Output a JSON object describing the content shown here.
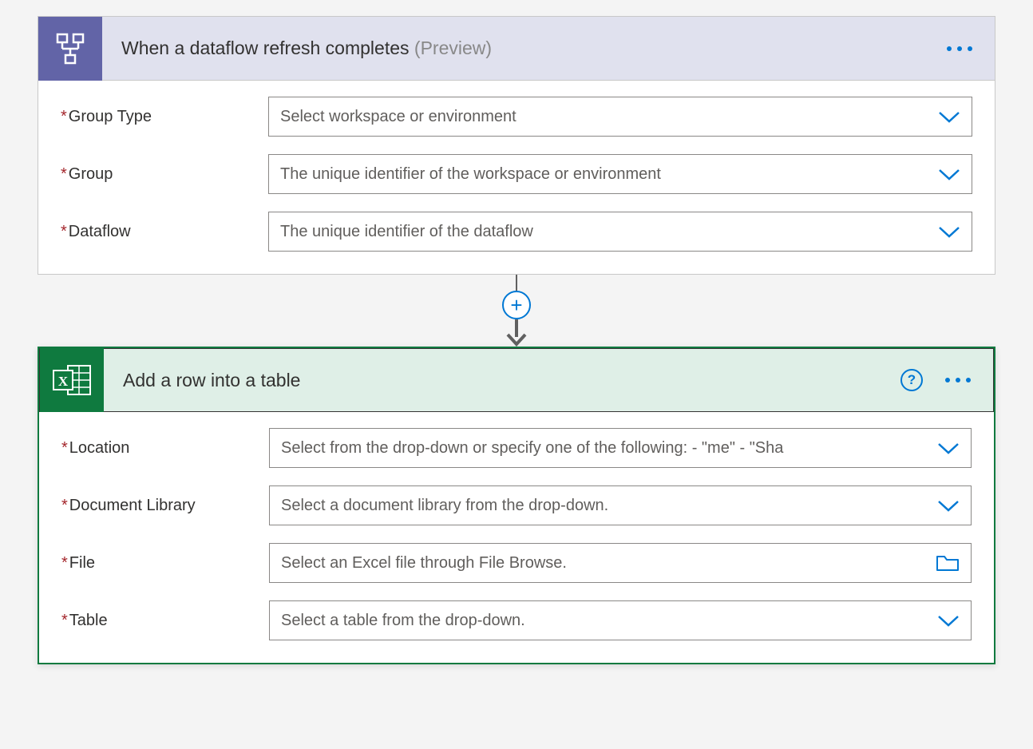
{
  "trigger": {
    "title": "When a dataflow refresh completes",
    "preview": "(Preview)",
    "fields": {
      "groupType": {
        "label": "Group Type",
        "placeholder": "Select workspace or environment"
      },
      "group": {
        "label": "Group",
        "placeholder": "The unique identifier of the workspace or environment"
      },
      "dataflow": {
        "label": "Dataflow",
        "placeholder": "The unique identifier of the dataflow"
      }
    }
  },
  "action": {
    "title": "Add a row into a table",
    "fields": {
      "location": {
        "label": "Location",
        "placeholder": "Select from the drop-down or specify one of the following: - \"me\" - \"Sha"
      },
      "documentLibrary": {
        "label": "Document Library",
        "placeholder": "Select a document library from the drop-down."
      },
      "file": {
        "label": "File",
        "placeholder": "Select an Excel file through File Browse."
      },
      "table": {
        "label": "Table",
        "placeholder": "Select a table from the drop-down."
      }
    }
  }
}
